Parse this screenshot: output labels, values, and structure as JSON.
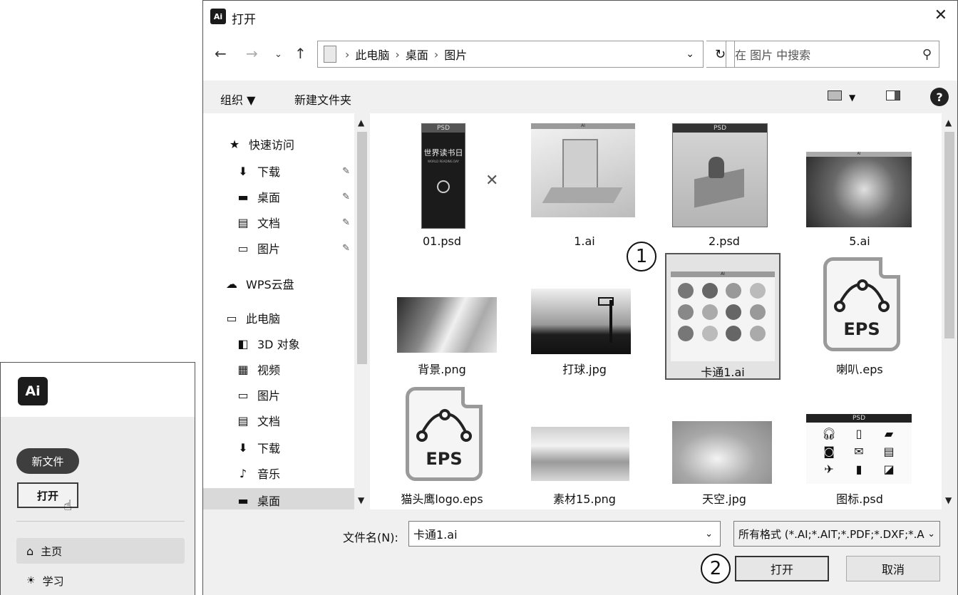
{
  "home": {
    "logo": "Ai",
    "new_file": "新文件",
    "open": "打开",
    "nav": [
      {
        "label": "主页",
        "icon": "home-icon"
      },
      {
        "label": "学习",
        "icon": "lightbulb-icon"
      }
    ]
  },
  "dialog": {
    "logo": "Ai",
    "title": "打开",
    "breadcrumb": [
      "此电脑",
      "桌面",
      "图片"
    ],
    "search_placeholder": "在 图片 中搜索",
    "toolbar": {
      "organize": "组织 ▼",
      "new_folder": "新建文件夹"
    },
    "nav": {
      "quick_access": "快速访问",
      "quick_items": [
        "下载",
        "桌面",
        "文档",
        "图片"
      ],
      "wps": "WPS云盘",
      "this_pc": "此电脑",
      "pc_items": [
        "3D 对象",
        "视频",
        "图片",
        "文档",
        "下载",
        "音乐",
        "桌面"
      ]
    },
    "files": [
      "01.psd",
      "1.ai",
      "2.psd",
      "5.ai",
      "背景.png",
      "打球.jpg",
      "卡通1.ai",
      "喇叭.eps",
      "猫头鹰logo.eps",
      "素材15.png",
      "天空.jpg",
      "图标.psd"
    ],
    "selected_file": "卡通1.ai",
    "thumb_labels": {
      "psd": "PSD",
      "ai": "AI",
      "eps": "EPS",
      "poster": "世界读书日",
      "poster_sub": "WORLD READING DAY"
    },
    "filename_label": "文件名(N):",
    "filename_value": "卡通1.ai",
    "filter_value": "所有格式 (*.AI;*.AIT;*.PDF;*.DXF;*.AI",
    "open_button": "打开",
    "cancel_button": "取消",
    "step_badges": [
      "1",
      "2"
    ]
  }
}
